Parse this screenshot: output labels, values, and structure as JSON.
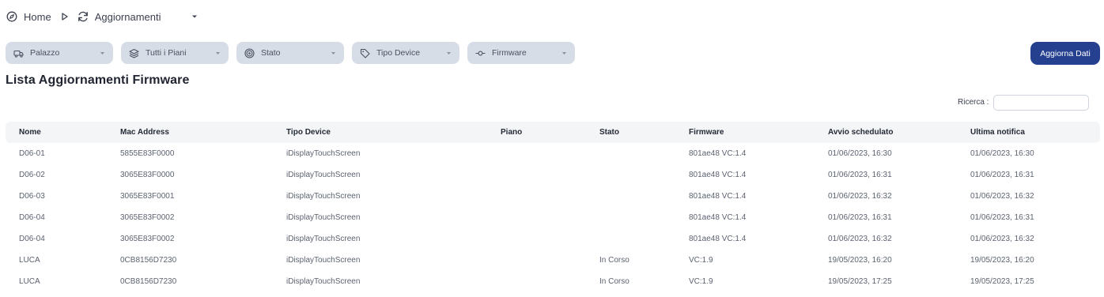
{
  "breadcrumb": {
    "home_label": "Home",
    "current_label": "Aggiornamenti"
  },
  "filters": [
    {
      "label": "Palazzo",
      "icon": "truck-icon"
    },
    {
      "label": "Tutti i Piani",
      "icon": "layers-icon"
    },
    {
      "label": "Stato",
      "icon": "target-icon"
    },
    {
      "label": "Tipo Device",
      "icon": "tag-icon"
    },
    {
      "label": "Firmware",
      "icon": "commit-icon"
    }
  ],
  "actions": {
    "refresh_label": "Aggiorna Dati"
  },
  "page_title": "Lista Aggiornamenti Firmware",
  "search": {
    "label": "Ricerca :",
    "value": "",
    "placeholder": ""
  },
  "table": {
    "columns": [
      "Nome",
      "Mac Address",
      "Tipo Device",
      "Piano",
      "Stato",
      "Firmware",
      "Avvio schedulato",
      "Ultima notifica"
    ],
    "rows": [
      [
        "D06-01",
        "5855E83F0000",
        "iDisplayTouchScreen",
        "",
        "",
        "801ae48 VC:1.4",
        "01/06/2023, 16:30",
        "01/06/2023, 16:30"
      ],
      [
        "D06-02",
        "3065E83F0000",
        "iDisplayTouchScreen",
        "",
        "",
        "801ae48 VC:1.4",
        "01/06/2023, 16:31",
        "01/06/2023, 16:31"
      ],
      [
        "D06-03",
        "3065E83F0001",
        "iDisplayTouchScreen",
        "",
        "",
        "801ae48 VC:1.4",
        "01/06/2023, 16:32",
        "01/06/2023, 16:32"
      ],
      [
        "D06-04",
        "3065E83F0002",
        "iDisplayTouchScreen",
        "",
        "",
        "801ae48 VC:1.4",
        "01/06/2023, 16:31",
        "01/06/2023, 16:31"
      ],
      [
        "D06-04",
        "3065E83F0002",
        "iDisplayTouchScreen",
        "",
        "",
        "801ae48 VC:1.4",
        "01/06/2023, 16:32",
        "01/06/2023, 16:32"
      ],
      [
        "LUCA",
        "0CB8156D7230",
        "iDisplayTouchScreen",
        "",
        "In Corso",
        "VC:1.9",
        "19/05/2023, 16:20",
        "19/05/2023, 16:20"
      ],
      [
        "LUCA",
        "0CB8156D7230",
        "iDisplayTouchScreen",
        "",
        "In Corso",
        "VC:1.9",
        "19/05/2023, 17:25",
        "19/05/2023, 17:25"
      ]
    ]
  },
  "colors": {
    "primary_button": "#24408f",
    "filter_background": "#d7dde7",
    "header_background": "#f4f5f7"
  }
}
